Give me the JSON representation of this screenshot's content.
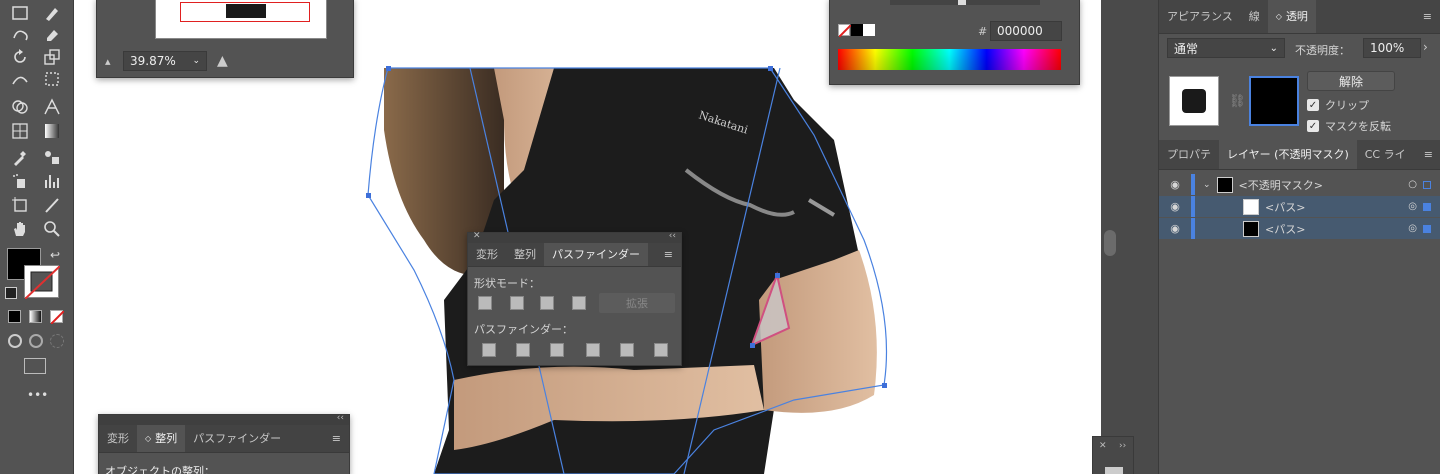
{
  "navigator": {
    "zoom": "39.87%"
  },
  "color_panel": {
    "hex_label": "#",
    "hex_value": "000000"
  },
  "transparency": {
    "tabs": [
      "アピアランス",
      "線",
      "透明"
    ],
    "blend_mode": "通常",
    "opacity_label": "不透明度：",
    "opacity_value": "100%",
    "release_button": "解除",
    "clip_label": "クリップ",
    "invert_label": "マスクを反転"
  },
  "layers_panel": {
    "tabs": [
      "プロパテ",
      "レイヤー (不透明マスク)",
      "CC ライ"
    ],
    "rows": [
      {
        "name": "<不透明マスク>"
      },
      {
        "name": "<パス>"
      },
      {
        "name": "<パス>"
      }
    ]
  },
  "pathfinder_float": {
    "tabs": [
      "変形",
      "整列",
      "パスファインダー"
    ],
    "shape_modes_label": "形状モード：",
    "expand_button": "拡張",
    "pathfinders_label": "パスファインダー："
  },
  "align_panel": {
    "tabs": [
      "変形",
      "整列",
      "パスファインダー"
    ],
    "section_label": "オブジェクトの整列："
  },
  "toolbar": {
    "more": "•••"
  }
}
